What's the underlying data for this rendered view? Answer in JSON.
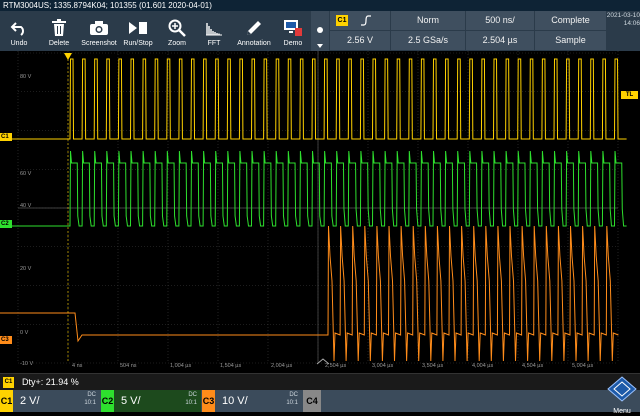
{
  "title": "RTM3004US; 1335.8794K04; 101355 (01.601 2020-04-01)",
  "toolbar": [
    {
      "label": "Undo",
      "icon": "undo-icon"
    },
    {
      "label": "Delete",
      "icon": "trash-icon"
    },
    {
      "label": "Screenshot",
      "icon": "camera-icon"
    },
    {
      "label": "Run/Stop",
      "icon": "run-stop-icon"
    },
    {
      "label": "Zoom",
      "icon": "zoom-icon"
    },
    {
      "label": "FFT",
      "icon": "fft-icon"
    },
    {
      "label": "Annotation",
      "icon": "pencil-icon"
    },
    {
      "label": "Demo",
      "icon": "demo-icon"
    }
  ],
  "header": {
    "trigger_source": "C1",
    "trigger_level": "2.56 V",
    "trigger_mode": "Norm",
    "sample_rate": "2.5 GSa/s",
    "time_scale": "500 ns/",
    "position": "2.504 µs",
    "acq_state": "Complete",
    "acq_mode": "Sample",
    "date": "2021-03-10",
    "time": "14:06"
  },
  "y_labels": [
    "80 V",
    "60 V",
    "40 V",
    "20 V",
    "0 V",
    "-10 V"
  ],
  "x_labels": [
    "4 ns",
    "504 ns",
    "1,004 µs",
    "1,504 µs",
    "2,004 µs",
    "2,504 µs",
    "3,004 µs",
    "3,504 µs",
    "4,004 µs",
    "4,504 µs",
    "5,004 µs"
  ],
  "markers": {
    "c1": "C1",
    "c2": "C2",
    "c3": "C3",
    "tl": "TL"
  },
  "measurement": {
    "source": "C1",
    "text": "Dty+: 21.94 %"
  },
  "channels": [
    {
      "tag": "C1",
      "scale": "2 V/",
      "coupling": "DC",
      "bw": "10:1",
      "color": "#ffd200"
    },
    {
      "tag": "C2",
      "scale": "5 V/",
      "coupling": "DC",
      "bw": "10:1",
      "color": "#2ee02e"
    },
    {
      "tag": "C3",
      "scale": "10 V/",
      "coupling": "DC",
      "bw": "10:1",
      "color": "#ff8c1a"
    },
    {
      "tag": "C4",
      "scale": "",
      "coupling": "",
      "bw": "",
      "color": "#888888"
    }
  ],
  "menu_label": "Menu",
  "colors": {
    "c1": "#ffd200",
    "c2": "#2ee02e",
    "c3": "#ff8c1a",
    "grid": "#3a3a3a"
  }
}
